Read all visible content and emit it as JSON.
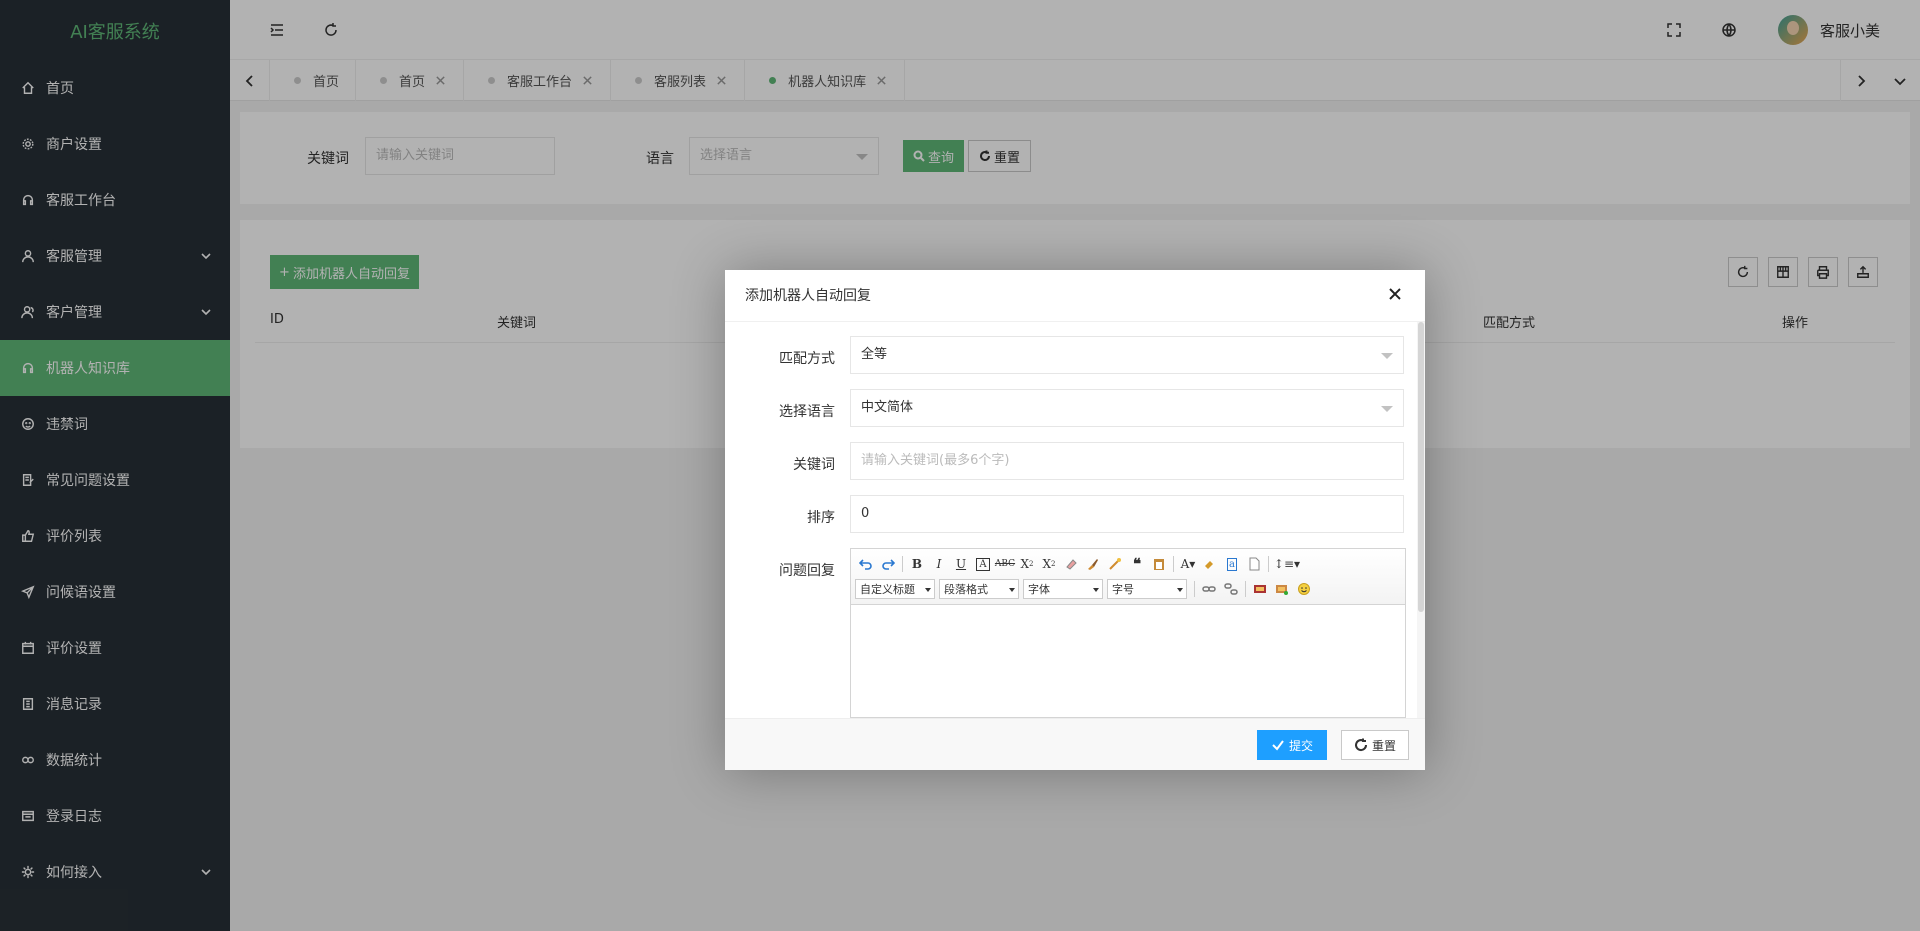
{
  "sidebar": {
    "logo": "AI客服系统",
    "items": [
      {
        "label": "首页",
        "icon": "home-icon"
      },
      {
        "label": "商户设置",
        "icon": "gear-icon"
      },
      {
        "label": "客服工作台",
        "icon": "headset-icon"
      },
      {
        "label": "客服管理",
        "icon": "user-icon"
      },
      {
        "label": "客户管理",
        "icon": "users-icon"
      },
      {
        "label": "机器人知识库",
        "icon": "robot-icon"
      },
      {
        "label": "违禁词",
        "icon": "face-icon"
      },
      {
        "label": "常见问题设置",
        "icon": "edit-icon"
      },
      {
        "label": "评价列表",
        "icon": "thumb-icon"
      },
      {
        "label": "问候语设置",
        "icon": "send-icon"
      },
      {
        "label": "评价设置",
        "icon": "calendar-icon"
      },
      {
        "label": "消息记录",
        "icon": "doc-icon"
      },
      {
        "label": "数据统计",
        "icon": "link-icon"
      },
      {
        "label": "登录日志",
        "icon": "log-icon"
      },
      {
        "label": "如何接入",
        "icon": "plug-icon"
      }
    ]
  },
  "header": {
    "user_name": "客服小美"
  },
  "tabs": [
    {
      "label": "首页"
    },
    {
      "label": "首页"
    },
    {
      "label": "客服工作台"
    },
    {
      "label": "客服列表"
    },
    {
      "label": "机器人知识库"
    }
  ],
  "search": {
    "keyword_label": "关键词",
    "keyword_placeholder": "请输入关键词",
    "language_label": "语言",
    "language_placeholder": "选择语言",
    "query_button": "查询",
    "reset_button": "重置"
  },
  "table": {
    "add_button": "添加机器人自动回复",
    "columns": [
      "ID",
      "关键词",
      "匹配方式",
      "操作"
    ]
  },
  "modal": {
    "title": "添加机器人自动回复",
    "match_label": "匹配方式",
    "match_value": "全等",
    "language_label": "选择语言",
    "language_value": "中文简体",
    "keyword_label": "关键词",
    "keyword_placeholder": "请输入关键词(最多6个字)",
    "sort_label": "排序",
    "sort_value": "0",
    "reply_label": "问题回复",
    "editor": {
      "heading_dropdown": "自定义标题",
      "paragraph_dropdown": "段落格式",
      "font_dropdown": "字体",
      "size_dropdown": "字号"
    },
    "submit_button": "提交",
    "reset_button": "重置"
  },
  "colors": {
    "accent": "#5fb878",
    "sidebar_bg": "#283037",
    "primary_blue": "#1e9fff"
  }
}
